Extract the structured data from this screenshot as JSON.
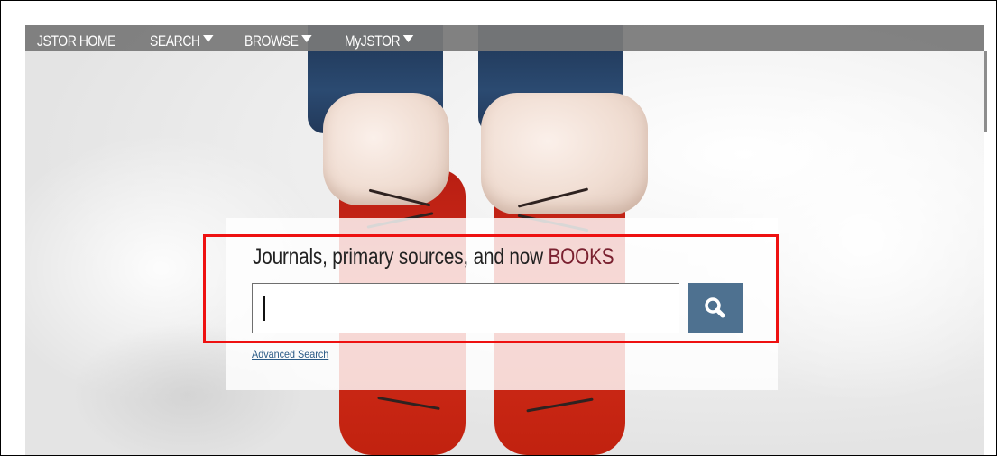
{
  "nav": {
    "items": [
      {
        "label": "JSTOR HOME",
        "dropdown": false
      },
      {
        "label": "SEARCH",
        "dropdown": true
      },
      {
        "label": "BROWSE",
        "dropdown": true
      },
      {
        "label": "MyJSTOR",
        "dropdown": true
      }
    ]
  },
  "hero": {
    "headline_prefix": "Journals, primary sources, and now ",
    "headline_highlight": "BOOKS",
    "search": {
      "value": "",
      "placeholder": ""
    },
    "search_button_icon": "search-icon",
    "advanced_search_label": "Advanced Search"
  },
  "colors": {
    "nav_bg": "#787878",
    "highlight_word": "#7a2130",
    "search_button": "#4e7190",
    "callout_border": "#ee1111",
    "link": "#2a5a86"
  }
}
